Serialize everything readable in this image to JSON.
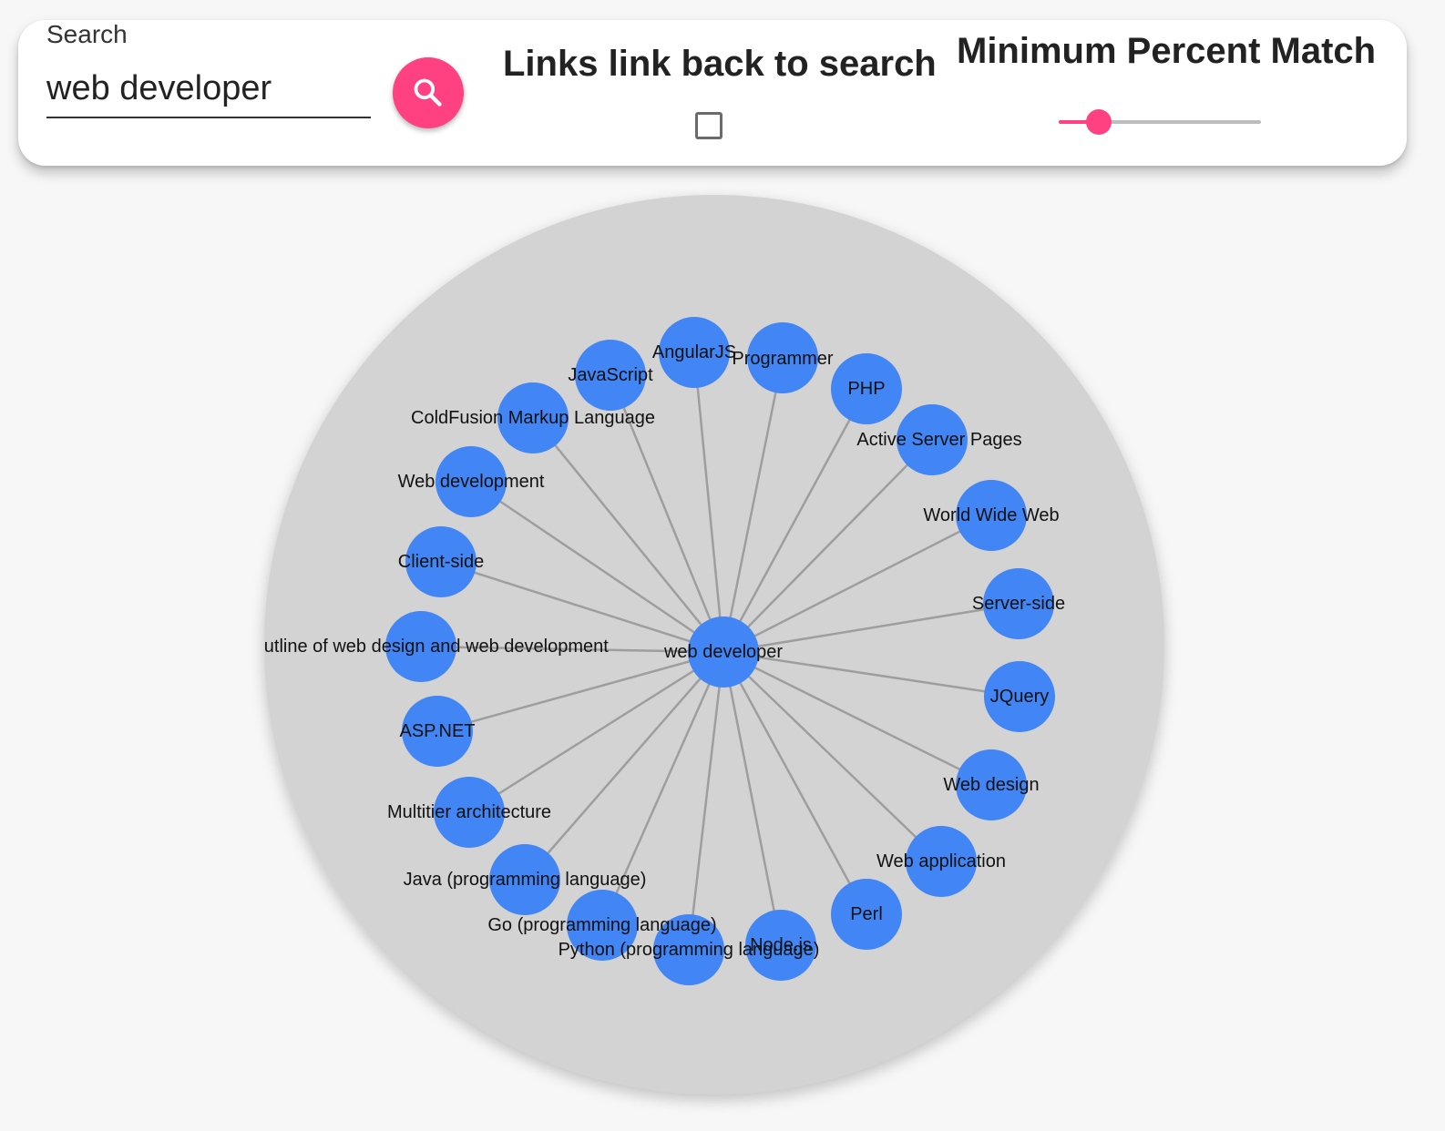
{
  "search": {
    "label": "Search",
    "value": "web developer",
    "button_icon": "search-icon"
  },
  "links_option": {
    "label": "Links link back to search",
    "checked": false
  },
  "match_option": {
    "label": "Minimum Percent Match",
    "slider_value": 0.2
  },
  "colors": {
    "accent": "#ff4081",
    "node": "#4285f4",
    "edge": "#9e9e9e",
    "graph_background": "#d3d3d3"
  },
  "graph": {
    "center": "web developer",
    "nodes": [
      "AngularJS",
      "Programmer",
      "PHP",
      "Active Server Pages",
      "World Wide Web",
      "Server-side",
      "JQuery",
      "Web design",
      "Web application",
      "Perl",
      "Node.js",
      "Python (programming language)",
      "Go (programming language)",
      "Java (programming language)",
      "Multitier architecture",
      "ASP.NET",
      "Outline of web design and web development",
      "Client-side",
      "Web development",
      "ColdFusion Markup Language",
      "JavaScript"
    ]
  }
}
